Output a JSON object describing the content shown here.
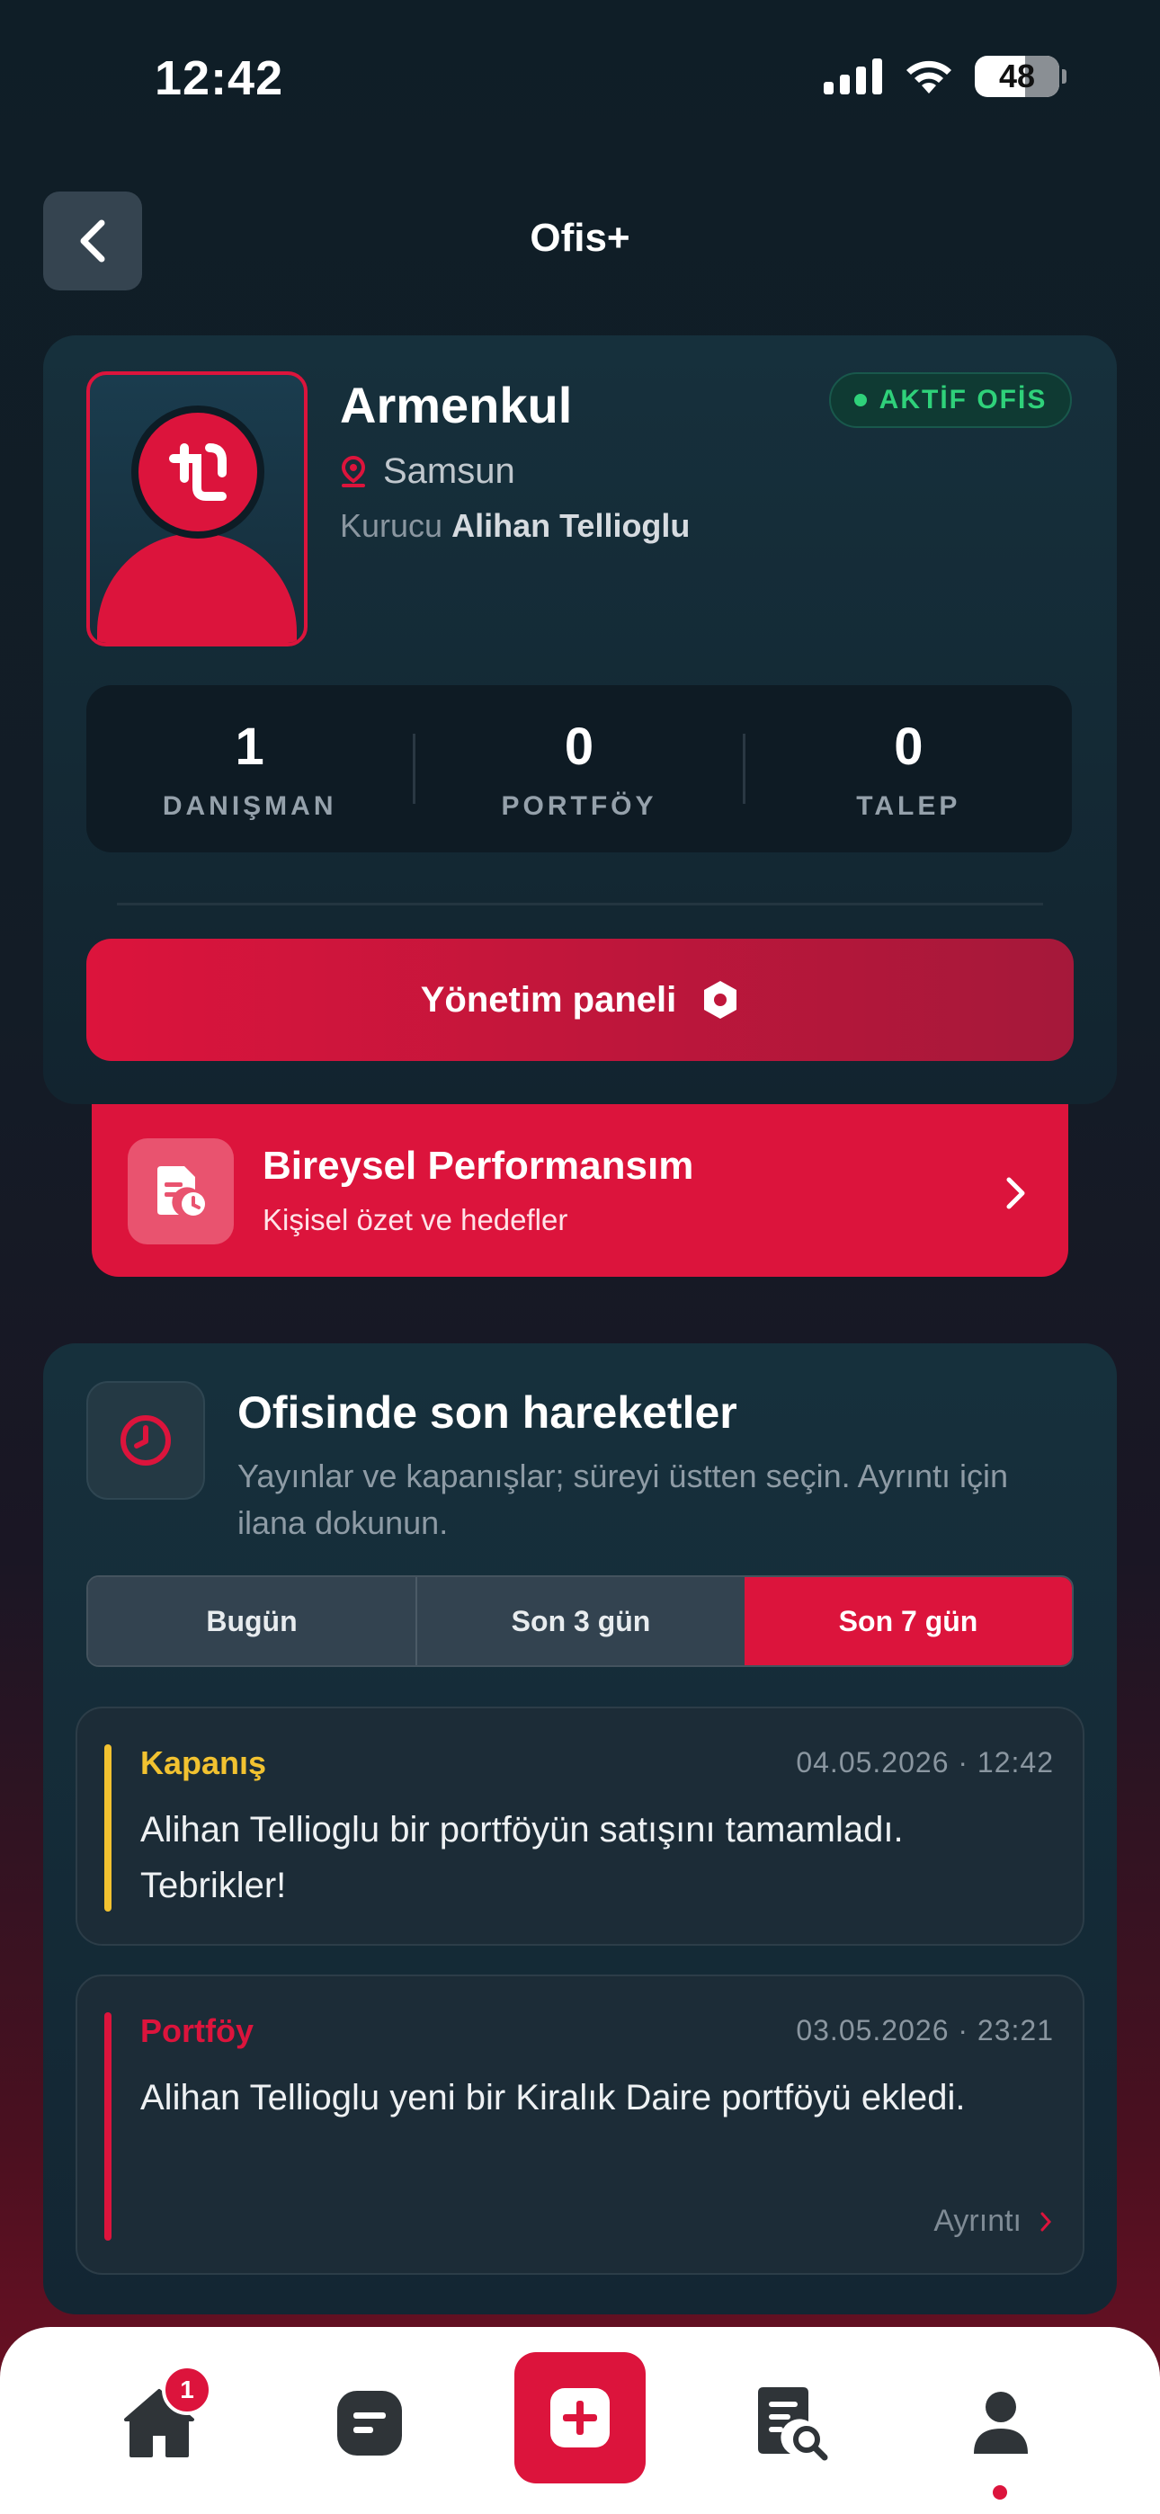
{
  "status_bar": {
    "time": "12:42",
    "battery": "48"
  },
  "header": {
    "title": "Ofis+"
  },
  "office": {
    "name": "Armenkul",
    "status_badge": "AKTİF OFİS",
    "city": "Samsun",
    "founder_label": "Kurucu",
    "founder_name": "Alihan Tellioglu",
    "stats": [
      {
        "value": "1",
        "label": "DANIŞMAN"
      },
      {
        "value": "0",
        "label": "PORTFÖY"
      },
      {
        "value": "0",
        "label": "TALEP"
      }
    ],
    "management_button": "Yönetim paneli"
  },
  "performance": {
    "title": "Bireysel Performansım",
    "subtitle": "Kişisel özet ve hedefler"
  },
  "activity": {
    "title": "Ofisinde son hareketler",
    "description": "Yayınlar ve kapanışlar; süreyi üstten seçin. Ayrıntı için ilana dokunun.",
    "filters": [
      "Bugün",
      "Son 3 gün",
      "Son 7 gün"
    ],
    "active_filter": "Son 7 gün",
    "events": [
      {
        "type": "Kapanış",
        "date": "04.05.2026 · 12:42",
        "text": "Alihan Tellioglu bir portföyün satışını tamamladı. Tebrikler!",
        "color": "#f2c230"
      },
      {
        "type": "Portföy",
        "date": "03.05.2026 · 23:21",
        "text": "Alihan Tellioglu yeni bir Kiralık Daire portföyü ekledi.",
        "color": "#dc143c",
        "link": "Ayrıntı"
      }
    ]
  },
  "tabbar": {
    "home_badge": "1",
    "items": [
      "home-icon",
      "messages-icon",
      "add-icon",
      "listing-search-icon",
      "profile-icon"
    ]
  },
  "colors": {
    "accent": "#dc143c",
    "success": "#2fd17a",
    "closing": "#f2c230"
  }
}
